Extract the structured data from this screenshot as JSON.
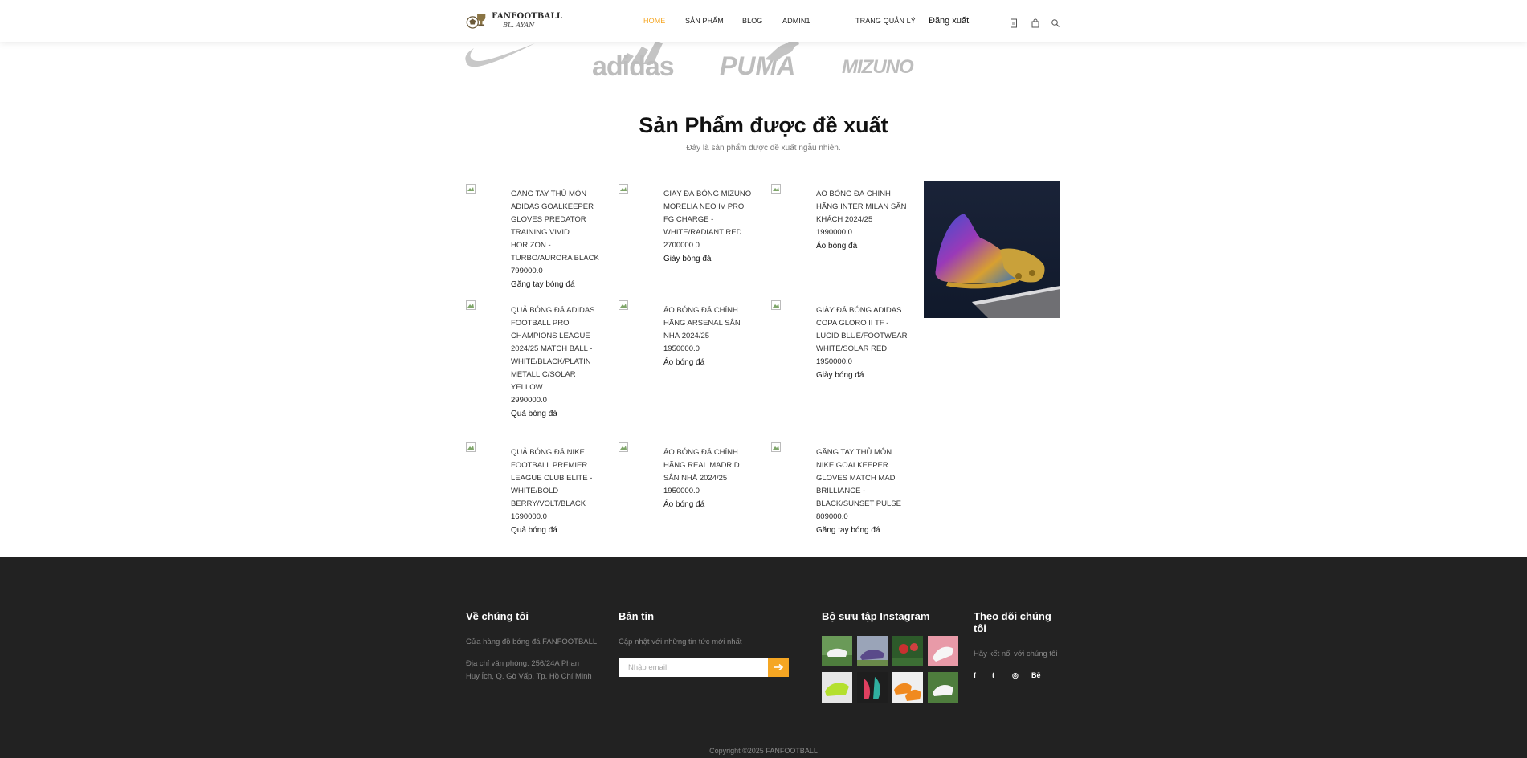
{
  "header": {
    "logo_name": "FANFOOTBALL",
    "logo_sub": "BL. AYAN",
    "nav": {
      "home": "HOME",
      "products": "SẢN PHẨM",
      "blog": "BLOG",
      "admin": "ADMIN1",
      "manage": "TRANG QUẢN LÝ"
    },
    "logout": "Đăng xuất",
    "icons": [
      "document-icon",
      "cart-icon",
      "search-icon"
    ],
    "accent_color": "#f5a623"
  },
  "brands": [
    "adidas",
    "PUMA",
    "MIZUNO"
  ],
  "section": {
    "title": "Sản Phẩm được đề xuất",
    "subtitle": "Đây là sản phẩm được đề xuất ngẫu nhiên."
  },
  "products": [
    {
      "name": "GĂNG TAY THỦ MÔN ADIDAS GOALKEEPER GLOVES PREDATOR TRAINING VIVID HORIZON - TURBO/AURORA BLACK",
      "price": "799000.0",
      "category": "Găng tay bóng đá"
    },
    {
      "name": "GIÀY ĐÁ BÓNG MIZUNO MORELIA NEO IV PRO FG CHARGE - WHITE/RADIANT RED",
      "price": "2700000.0",
      "category": "Giày bóng đá"
    },
    {
      "name": "ÁO BÓNG ĐÁ CHÍNH HÃNG INTER MILAN SÂN KHÁCH 2024/25",
      "price": "1990000.0",
      "category": "Áo bóng đá"
    },
    {
      "name": "QUẢ BÓNG ĐÁ ADIDAS FOOTBALL PRO CHAMPIONS LEAGUE 2024/25 MATCH BALL - WHITE/BLACK/PLATIN METALLIC/SOLAR YELLOW",
      "price": "2990000.0",
      "category": "Quả bóng đá"
    },
    {
      "name": "ÁO BÓNG ĐÁ CHÍNH HÃNG ARSENAL SÂN NHÀ 2024/25",
      "price": "1950000.0",
      "category": "Áo bóng đá"
    },
    {
      "name": "GIÀY ĐÁ BÓNG ADIDAS COPA GLORO II TF - LUCID BLUE/FOOTWEAR WHITE/SOLAR RED",
      "price": "1950000.0",
      "category": "Giày bóng đá"
    },
    {
      "name": "QUẢ BÓNG ĐÁ NIKE FOOTBALL PREMIER LEAGUE CLUB ELITE - WHITE/BOLD BERRY/VOLT/BLACK",
      "price": "1690000.0",
      "category": "Quả bóng đá"
    },
    {
      "name": "ÁO BÓNG ĐÁ CHÍNH HÃNG REAL MADRID SÂN NHÀ 2024/25",
      "price": "1950000.0",
      "category": "Áo bóng đá"
    },
    {
      "name": "GĂNG TAY THỦ MÔN NIKE GOALKEEPER GLOVES MATCH MAD BRILLIANCE - BLACK/SUNSET PULSE",
      "price": "809000.0",
      "category": "Găng tay bóng đá"
    }
  ],
  "footer": {
    "about": {
      "title": "Về chúng tôi",
      "line1": "Cửa hàng đồ bóng đá FANFOOTBALL",
      "address": "Địa chỉ văn phòng: 256/24A Phan Huy Ích, Q. Gò Vấp, Tp. Hồ Chí Minh"
    },
    "newsletter": {
      "title": "Bản tin",
      "text": "Cập nhật với những tin tức mới nhất",
      "placeholder": "Nhập email"
    },
    "instagram": {
      "title": "Bộ sưu tập Instagram"
    },
    "follow": {
      "title": "Theo dõi chúng tôi",
      "text": "Hãy kết nối với chúng tôi",
      "icons": [
        "f",
        "t",
        "◎",
        "Bē"
      ]
    },
    "copyright": "Copyright ©2025 FANFOOTBALL",
    "bg_color": "#222222"
  }
}
